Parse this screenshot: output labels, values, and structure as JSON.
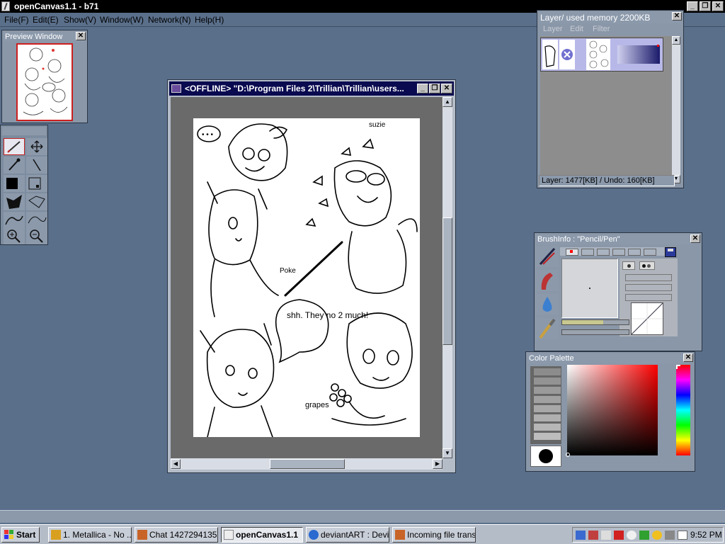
{
  "app": {
    "title": "openCanvas1.1 - b71"
  },
  "menu": [
    "File(F)",
    "Edit(E)",
    "Show(V)",
    "Window(W)",
    "Network(N)",
    "Help(H)"
  ],
  "window_controls": {
    "minimize": "_",
    "restore": "❐",
    "close": "✕"
  },
  "preview": {
    "title": "Preview Window",
    "close": "✕"
  },
  "document": {
    "title": "<OFFLINE>  \"D:\\Program Files 2\\Trillian\\Trillian\\users...",
    "canvas_text": {
      "top_right": "suzie",
      "speech_left": "• • •",
      "poke": "Poke",
      "shh": "shh. They no 2 much!",
      "grapes": "grapes"
    }
  },
  "tools": [
    "pencil-icon",
    "move-icon",
    "eyedropper-icon",
    "line-icon",
    "fill-color-icon",
    "selection-icon",
    "polygon-fill-icon",
    "polygon-select-icon",
    "curve-icon",
    "curve-select-icon",
    "zoom-in-icon",
    "zoom-out-icon"
  ],
  "layer": {
    "title": "Layer/ used memory 2200KB",
    "menu": [
      "Layer",
      "Edit",
      "Filter"
    ],
    "status": "Layer: 1477[KB] / Undo: 160[KB]"
  },
  "brush": {
    "title": "BrushInfo : \"Pencil/Pen\""
  },
  "color": {
    "title": "Color Palette",
    "accent": "#ff0000",
    "greys": [
      "#8c8c8c",
      "#939393",
      "#9a9a9a",
      "#a1a1a1",
      "#a8a8a8",
      "#afafaf",
      "#b6b6b6",
      "#bdbdbd"
    ]
  },
  "taskbar": {
    "start": "Start",
    "tasks": [
      "1. Metallica - No ...",
      "Chat 1427294135...",
      "openCanvas1.1",
      "deviantART : Devi...",
      "Incoming file trans..."
    ],
    "time": "9:52 PM"
  }
}
